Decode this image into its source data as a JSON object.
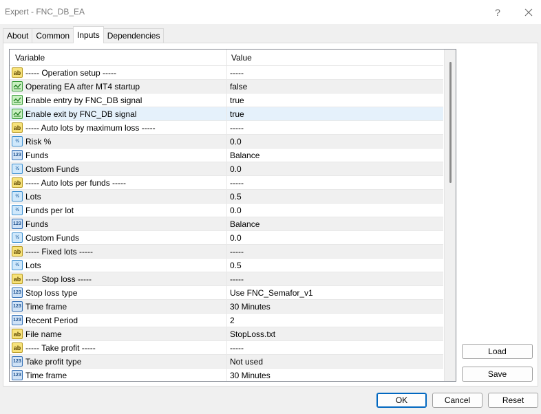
{
  "window": {
    "title": "Expert - FNC_DB_EA",
    "help_glyph": "?",
    "close_glyph": "✕"
  },
  "tabs": [
    {
      "label": "About"
    },
    {
      "label": "Common"
    },
    {
      "label": "Inputs",
      "active": true
    },
    {
      "label": "Dependencies"
    }
  ],
  "grid": {
    "col_variable": "Variable",
    "col_value": "Value",
    "rows": [
      {
        "icon": "ab",
        "variable": "----- Operation setup -----",
        "value": "-----"
      },
      {
        "icon": "bool",
        "variable": "Operating EA after MT4 startup",
        "value": "false"
      },
      {
        "icon": "bool",
        "variable": "Enable entry by FNC_DB signal",
        "value": "true"
      },
      {
        "icon": "bool",
        "variable": "Enable exit by FNC_DB signal",
        "value": "true"
      },
      {
        "icon": "ab",
        "variable": "----- Auto lots by maximum loss -----",
        "value": "-----"
      },
      {
        "icon": "dbl",
        "variable": "Risk %",
        "value": "0.0"
      },
      {
        "icon": "int",
        "variable": "Funds",
        "value": "Balance"
      },
      {
        "icon": "dbl",
        "variable": "Custom Funds",
        "value": "0.0"
      },
      {
        "icon": "ab",
        "variable": "----- Auto lots per funds -----",
        "value": "-----"
      },
      {
        "icon": "dbl",
        "variable": "Lots",
        "value": "0.5"
      },
      {
        "icon": "dbl",
        "variable": "Funds per lot",
        "value": "0.0"
      },
      {
        "icon": "int",
        "variable": "Funds",
        "value": "Balance"
      },
      {
        "icon": "dbl",
        "variable": "Custom Funds",
        "value": "0.0"
      },
      {
        "icon": "ab",
        "variable": "----- Fixed lots -----",
        "value": "-----"
      },
      {
        "icon": "dbl",
        "variable": "Lots",
        "value": "0.5"
      },
      {
        "icon": "ab",
        "variable": "----- Stop loss -----",
        "value": "-----"
      },
      {
        "icon": "int",
        "variable": "Stop loss type",
        "value": "Use FNC_Semafor_v1"
      },
      {
        "icon": "int",
        "variable": "Time frame",
        "value": "30 Minutes"
      },
      {
        "icon": "int",
        "variable": "Recent Period",
        "value": "2"
      },
      {
        "icon": "ab",
        "variable": "File name",
        "value": "StopLoss.txt"
      },
      {
        "icon": "ab",
        "variable": "----- Take profit -----",
        "value": "-----"
      },
      {
        "icon": "int",
        "variable": "Take profit type",
        "value": "Not used"
      },
      {
        "icon": "int",
        "variable": "Time frame",
        "value": "30 Minutes"
      }
    ]
  },
  "icon_glyphs": {
    "ab": "ab",
    "dbl": "½",
    "int": "123"
  },
  "buttons": {
    "load": "Load",
    "save": "Save",
    "ok": "OK",
    "cancel": "Cancel",
    "reset": "Reset"
  }
}
